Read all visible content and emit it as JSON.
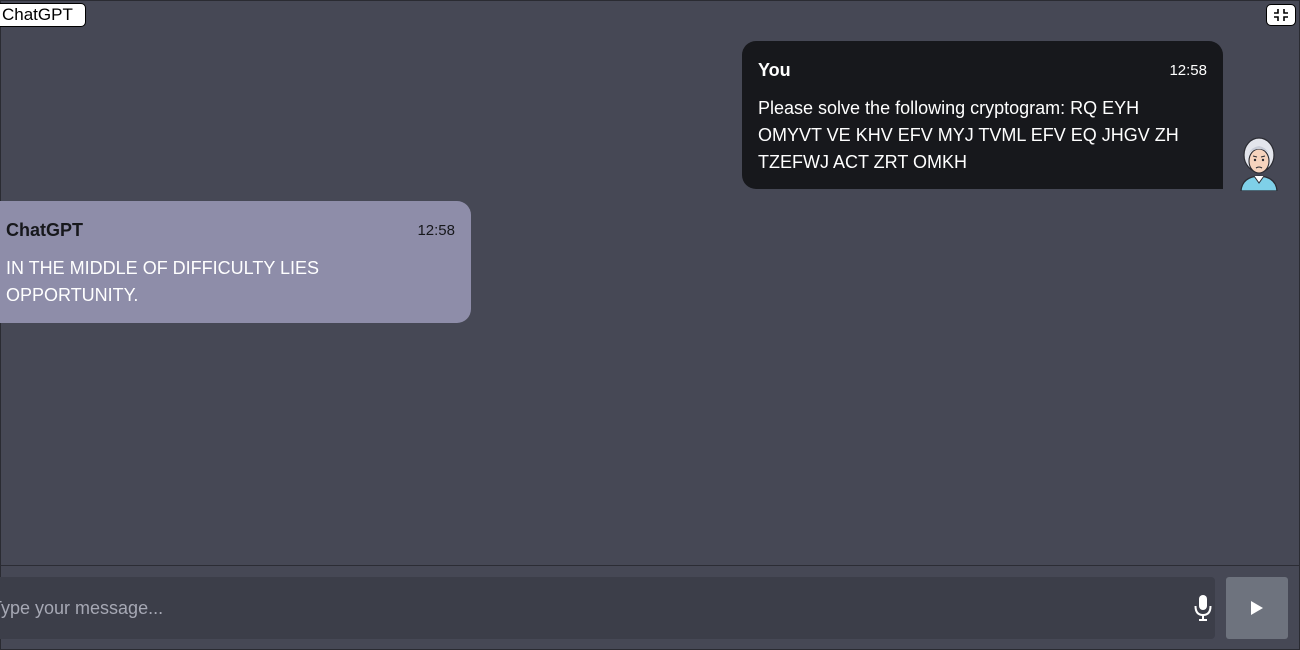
{
  "window": {
    "title": "ChatGPT"
  },
  "messages": [
    {
      "sender": "You",
      "time": "12:58",
      "text": "Please solve the following cryptogram: RQ EYH OMYVT VE KHV EFV MYJ TVML EFV EQ JHGV ZH TZEFWJ ACT ZRT OMKH"
    },
    {
      "sender": "ChatGPT",
      "time": "12:58",
      "text": "IN THE MIDDLE OF DIFFICULTY LIES OPPORTUNITY."
    }
  ],
  "composer": {
    "placeholder": "Type your message...",
    "value": ""
  },
  "icons": {
    "collapse": "collapse-icon",
    "user_avatar": "avatar",
    "mic": "microphone-icon",
    "send": "send-icon"
  },
  "colors": {
    "background": "#464855",
    "user_bubble": "#17181c",
    "bot_bubble": "#8e8da9",
    "send_button": "#6e737e"
  }
}
